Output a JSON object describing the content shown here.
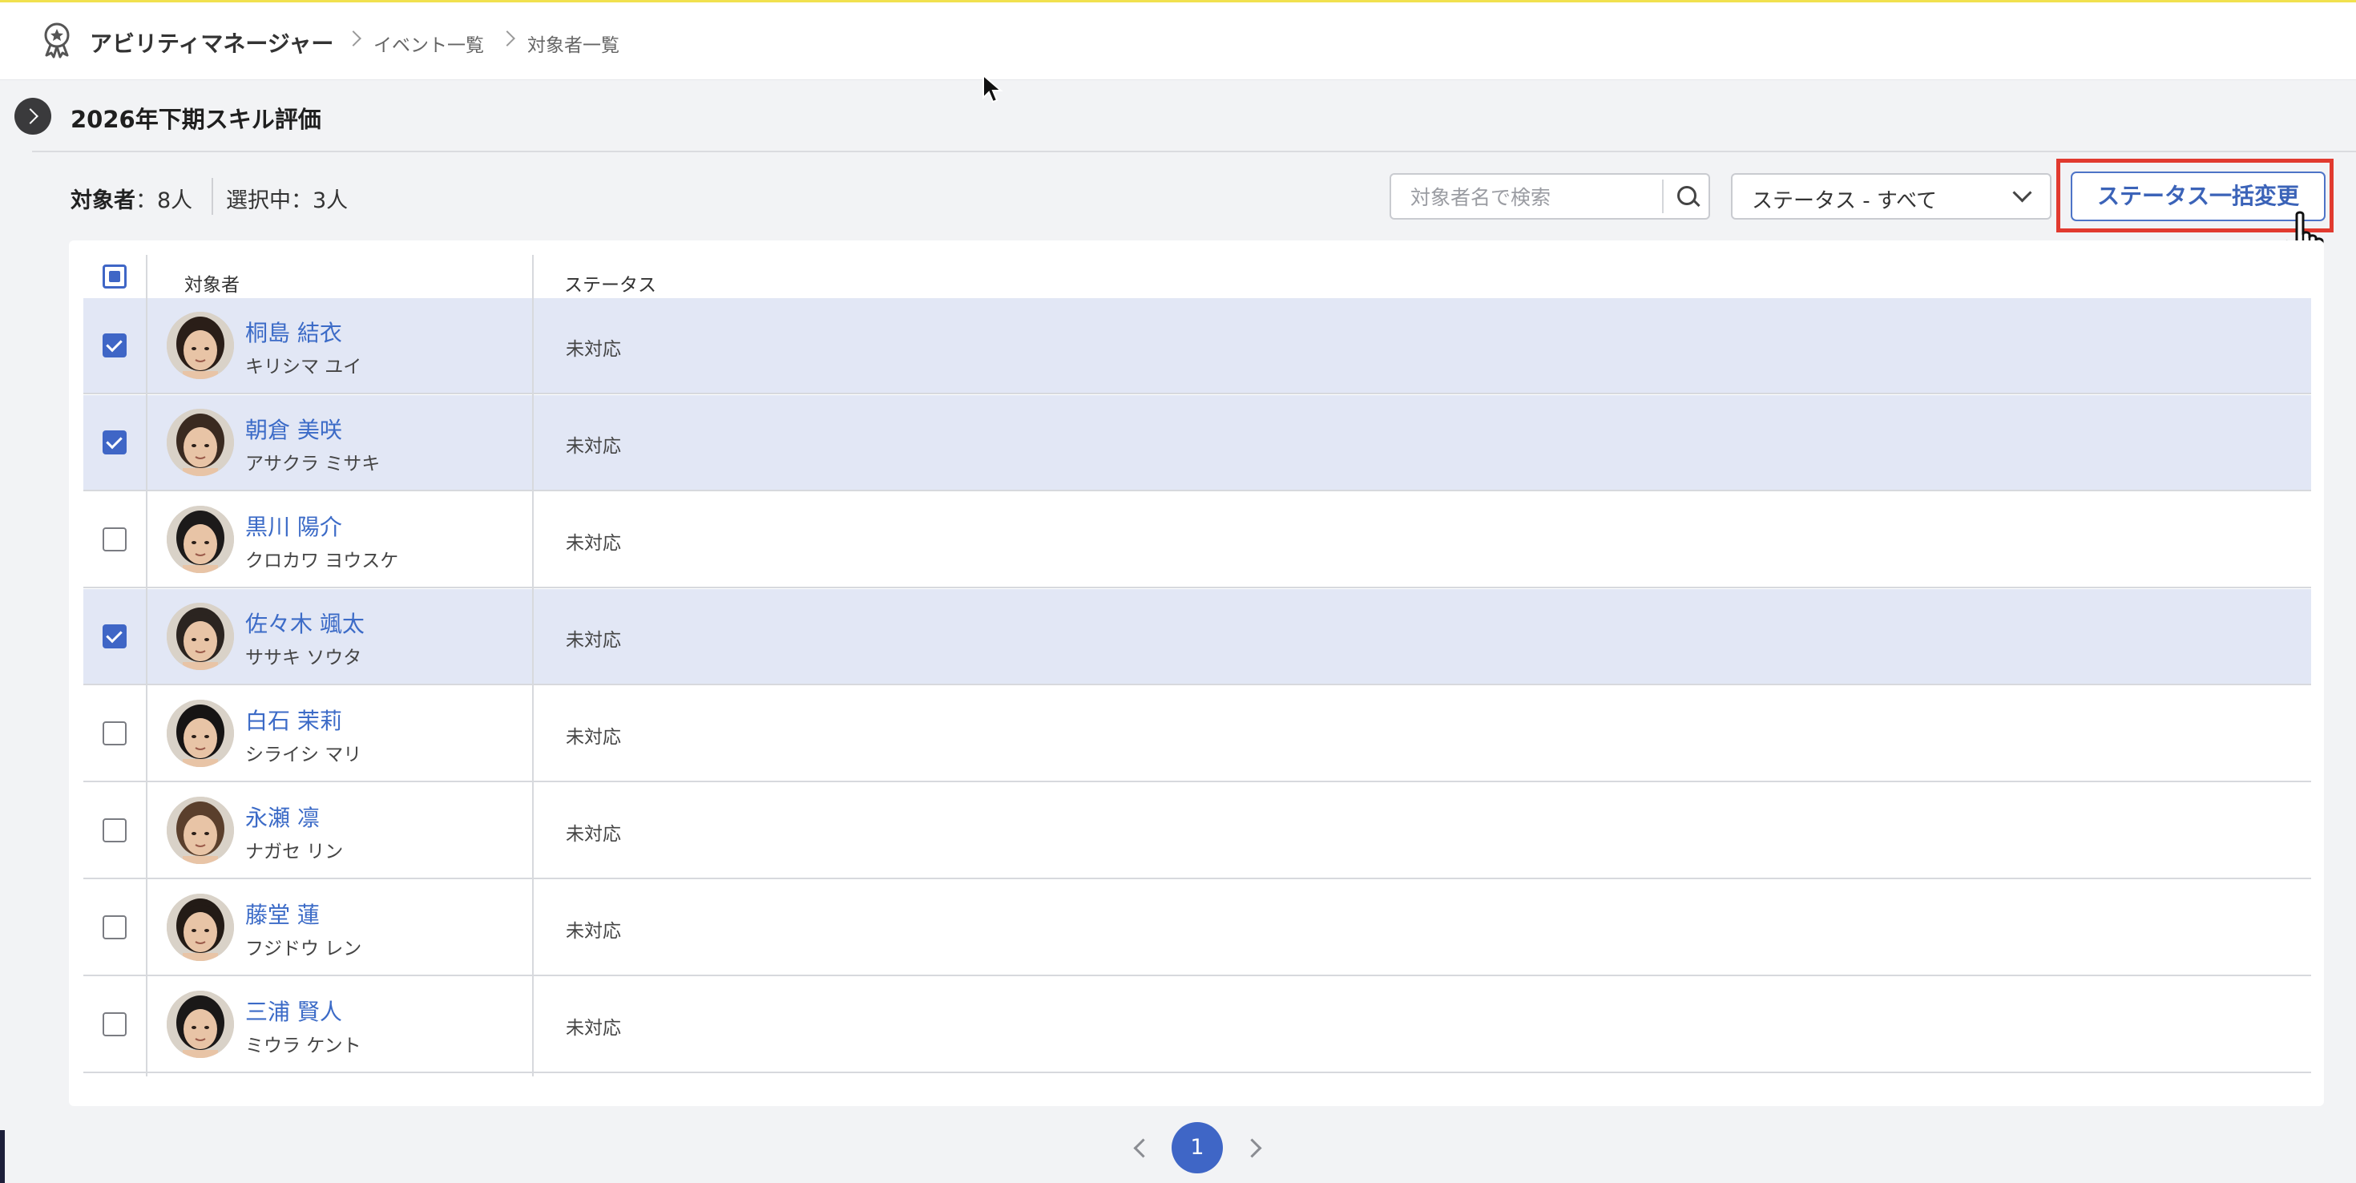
{
  "header": {
    "app_title": "アビリティマネージャー",
    "breadcrumbs": [
      "イベント一覧",
      "対象者一覧"
    ]
  },
  "page": {
    "title": "2026年下期スキル評価"
  },
  "summary": {
    "count_label": "対象者",
    "count_value": "：8人",
    "selected_text": "選択中：3人"
  },
  "search": {
    "placeholder": "対象者名で検索",
    "value": ""
  },
  "filter": {
    "status_selected": "ステータス - すべて"
  },
  "bulk_button_label": "ステータス一括変更",
  "table": {
    "headers": [
      "対象者",
      "ステータス"
    ],
    "rows": [
      {
        "name": "桐島 結衣",
        "kana": "キリシマ ユイ",
        "status": "未対応",
        "checked": true
      },
      {
        "name": "朝倉 美咲",
        "kana": "アサクラ ミサキ",
        "status": "未対応",
        "checked": true
      },
      {
        "name": "黒川 陽介",
        "kana": "クロカワ ヨウスケ",
        "status": "未対応",
        "checked": false
      },
      {
        "name": "佐々木 颯太",
        "kana": "ササキ ソウタ",
        "status": "未対応",
        "checked": true
      },
      {
        "name": "白石 茉莉",
        "kana": "シライシ マリ",
        "status": "未対応",
        "checked": false
      },
      {
        "name": "永瀬 凛",
        "kana": "ナガセ リン",
        "status": "未対応",
        "checked": false
      },
      {
        "name": "藤堂 蓮",
        "kana": "フジドウ レン",
        "status": "未対応",
        "checked": false
      },
      {
        "name": "三浦 賢人",
        "kana": "ミウラ ケント",
        "status": "未対応",
        "checked": false
      }
    ]
  },
  "pagination": {
    "current_page": "1"
  },
  "colors": {
    "accent": "#3f66c6",
    "selected_row": "#e2e7f5",
    "highlight": "#e13a2f",
    "top_accent": "#f1e14e"
  }
}
